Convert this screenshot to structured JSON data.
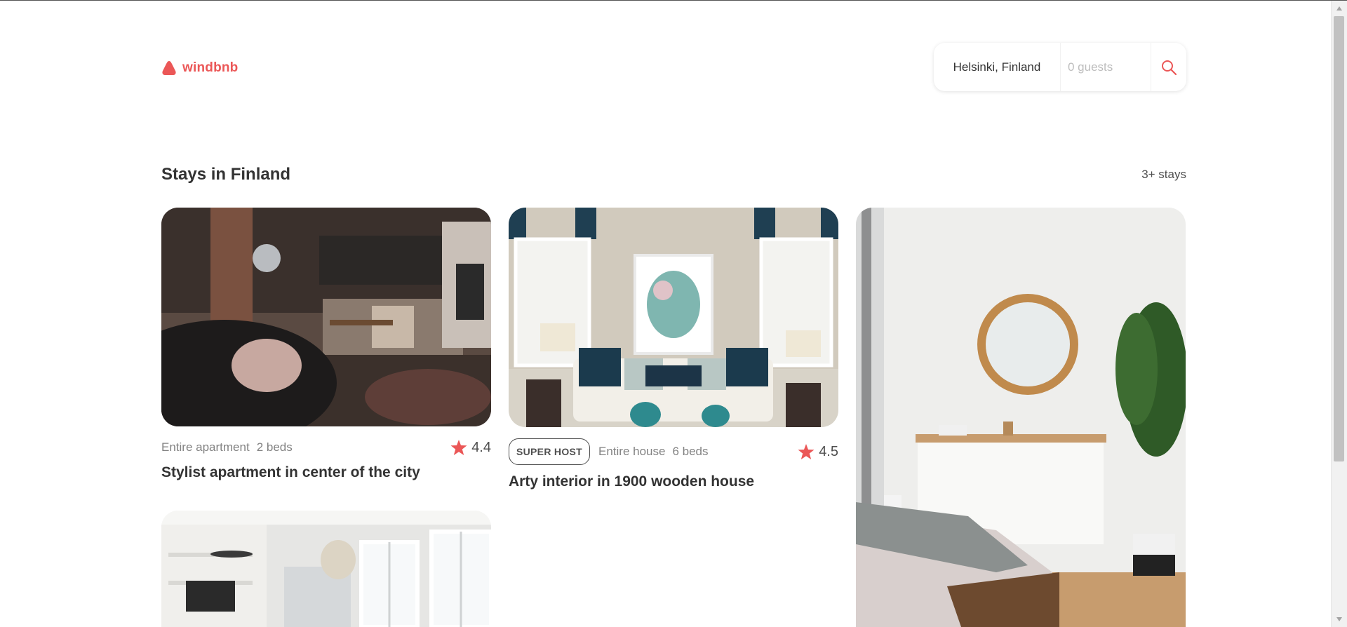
{
  "brand": {
    "name": "windbnb",
    "color": "#eb5757"
  },
  "search": {
    "location": "Helsinki, Finland",
    "guests_placeholder": "0 guests",
    "icon": "search-icon"
  },
  "section": {
    "title": "Stays in Finland",
    "count": "3+ stays"
  },
  "stays": [
    {
      "type": "Entire apartment",
      "beds": "2 beds",
      "rating": "4.4",
      "title": "Stylist apartment in center of the city",
      "superhost": ""
    },
    {
      "type": "Entire house",
      "beds": "6 beds",
      "rating": "4.5",
      "title": "Arty interior in 1900 wooden house",
      "superhost": "SUPER HOST"
    }
  ],
  "icons": {
    "star": "star-icon",
    "logo": "windbnb-logo-icon"
  }
}
